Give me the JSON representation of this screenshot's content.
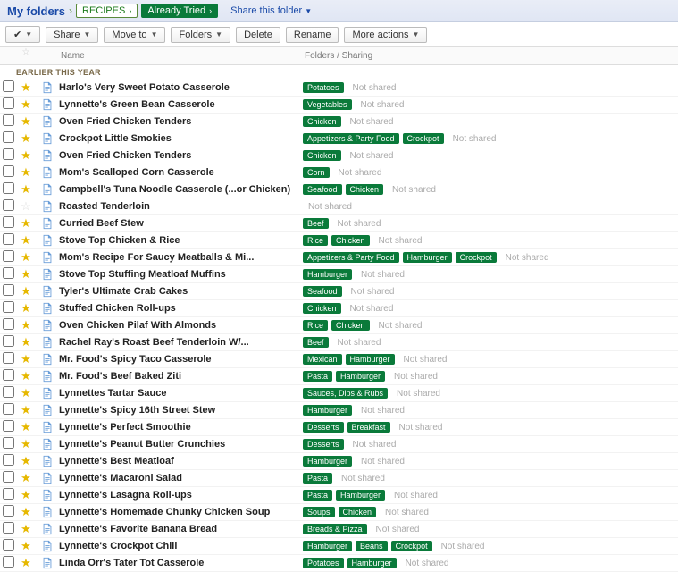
{
  "breadcrumb": {
    "root": "My folders",
    "items": [
      "RECIPES",
      "Already Tried"
    ],
    "share_label": "Share this folder"
  },
  "toolbar": {
    "check_menu": "✔",
    "share": "Share",
    "move_to": "Move to",
    "folders": "Folders",
    "delete": "Delete",
    "rename": "Rename",
    "more": "More actions"
  },
  "columns": {
    "name": "Name",
    "share": "Folders / Sharing"
  },
  "section": "EARLIER THIS YEAR",
  "not_shared": "Not shared",
  "items": [
    {
      "star": true,
      "name": "Harlo's Very Sweet Potato Casserole",
      "tags": [
        "Potatoes"
      ],
      "shared": false
    },
    {
      "star": true,
      "name": "Lynnette's Green Bean Casserole",
      "tags": [
        "Vegetables"
      ],
      "shared": false
    },
    {
      "star": true,
      "name": "Oven Fried Chicken Tenders",
      "tags": [
        "Chicken"
      ],
      "shared": false
    },
    {
      "star": true,
      "name": "Crockpot Little Smokies",
      "tags": [
        "Appetizers & Party Food",
        "Crockpot"
      ],
      "shared": false
    },
    {
      "star": true,
      "name": "Oven Fried Chicken Tenders",
      "tags": [
        "Chicken"
      ],
      "shared": false
    },
    {
      "star": true,
      "name": "Mom's Scalloped Corn Casserole",
      "tags": [
        "Corn"
      ],
      "shared": false
    },
    {
      "star": true,
      "name": "Campbell's Tuna Noodle Casserole (...or Chicken)",
      "tags": [
        "Seafood",
        "Chicken"
      ],
      "shared": false
    },
    {
      "star": false,
      "name": "Roasted Tenderloin",
      "tags": [],
      "shared": false
    },
    {
      "star": true,
      "name": "Curried Beef Stew",
      "tags": [
        "Beef"
      ],
      "shared": false
    },
    {
      "star": true,
      "name": "Stove Top Chicken & Rice",
      "tags": [
        "Rice",
        "Chicken"
      ],
      "shared": false
    },
    {
      "star": true,
      "name": "Mom's Recipe For Saucy Meatballs & Mi...",
      "tags": [
        "Appetizers & Party Food",
        "Hamburger",
        "Crockpot"
      ],
      "shared": false
    },
    {
      "star": true,
      "name": "Stove Top Stuffing Meatloaf Muffins",
      "tags": [
        "Hamburger"
      ],
      "shared": false
    },
    {
      "star": true,
      "name": "Tyler's Ultimate Crab Cakes",
      "tags": [
        "Seafood"
      ],
      "shared": false
    },
    {
      "star": true,
      "name": "Stuffed Chicken Roll-ups",
      "tags": [
        "Chicken"
      ],
      "shared": false
    },
    {
      "star": true,
      "name": "Oven Chicken Pilaf With Almonds",
      "tags": [
        "Rice",
        "Chicken"
      ],
      "shared": false
    },
    {
      "star": true,
      "name": "Rachel Ray's Roast Beef Tenderloin W/...",
      "tags": [
        "Beef"
      ],
      "shared": false
    },
    {
      "star": true,
      "name": "Mr. Food's Spicy Taco Casserole",
      "tags": [
        "Mexican",
        "Hamburger"
      ],
      "shared": false
    },
    {
      "star": true,
      "name": "Mr. Food's Beef Baked Ziti",
      "tags": [
        "Pasta",
        "Hamburger"
      ],
      "shared": false
    },
    {
      "star": true,
      "name": "Lynnettes Tartar Sauce",
      "tags": [
        "Sauces, Dips & Rubs"
      ],
      "shared": false
    },
    {
      "star": true,
      "name": "Lynnette's Spicy 16th Street Stew",
      "tags": [
        "Hamburger"
      ],
      "shared": false
    },
    {
      "star": true,
      "name": "Lynnette's Perfect Smoothie",
      "tags": [
        "Desserts",
        "Breakfast"
      ],
      "shared": false
    },
    {
      "star": true,
      "name": "Lynnette's Peanut Butter Crunchies",
      "tags": [
        "Desserts"
      ],
      "shared": false
    },
    {
      "star": true,
      "name": "Lynnette's Best Meatloaf",
      "tags": [
        "Hamburger"
      ],
      "shared": false
    },
    {
      "star": true,
      "name": "Lynnette's Macaroni Salad",
      "tags": [
        "Pasta"
      ],
      "shared": false
    },
    {
      "star": true,
      "name": "Lynnette's Lasagna Roll-ups",
      "tags": [
        "Pasta",
        "Hamburger"
      ],
      "shared": false
    },
    {
      "star": true,
      "name": "Lynnette's Homemade Chunky Chicken Soup",
      "tags": [
        "Soups",
        "Chicken"
      ],
      "shared": false
    },
    {
      "star": true,
      "name": "Lynnette's Favorite Banana Bread",
      "tags": [
        "Breads & Pizza"
      ],
      "shared": false
    },
    {
      "star": true,
      "name": "Lynnette's Crockpot Chili",
      "tags": [
        "Hamburger",
        "Beans",
        "Crockpot"
      ],
      "shared": false
    },
    {
      "star": true,
      "name": "Linda Orr's Tater Tot Casserole",
      "tags": [
        "Potatoes",
        "Hamburger"
      ],
      "shared": false
    }
  ]
}
